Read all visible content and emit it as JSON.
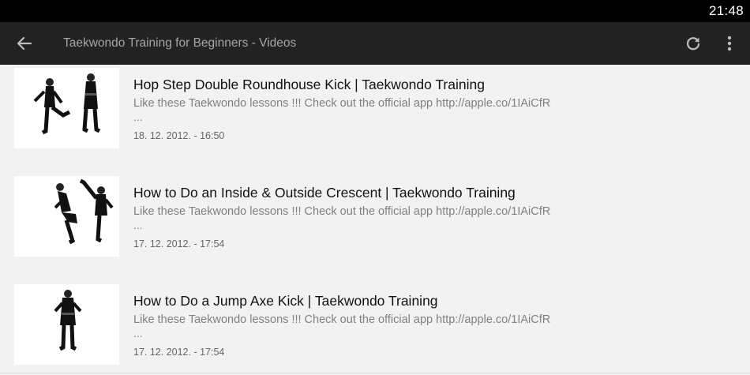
{
  "status_bar": {
    "time": "21:48"
  },
  "action_bar": {
    "title": "Taekwondo Training for Beginners - Videos",
    "back_icon": "arrow-left-icon",
    "refresh_icon": "refresh-icon",
    "menu_icon": "overflow-menu-icon"
  },
  "videos": [
    {
      "title": "Hop Step Double Roundhouse Kick | Taekwondo Training",
      "description": "Like these Taekwondo lessons !!! Check out the official app http://apple.co/1IAiCfR",
      "ellipsis": "...",
      "date": "18. 12. 2012. - 16:50"
    },
    {
      "title": "How to Do an Inside & Outside Crescent | Taekwondo Training",
      "description": "Like these Taekwondo lessons !!! Check out the official app http://apple.co/1IAiCfR",
      "ellipsis": "...",
      "date": "17. 12. 2012. - 17:54"
    },
    {
      "title": "How to Do a Jump Axe Kick | Taekwondo Training",
      "description": "Like these Taekwondo lessons !!! Check out the official app http://apple.co/1IAiCfR",
      "ellipsis": "...",
      "date": "17. 12. 2012. - 17:54"
    }
  ],
  "colors": {
    "status_bar": "#000000",
    "action_bar": "#222222",
    "background": "#f2f2f2",
    "title_text": "#111111",
    "secondary_text": "#808080"
  }
}
